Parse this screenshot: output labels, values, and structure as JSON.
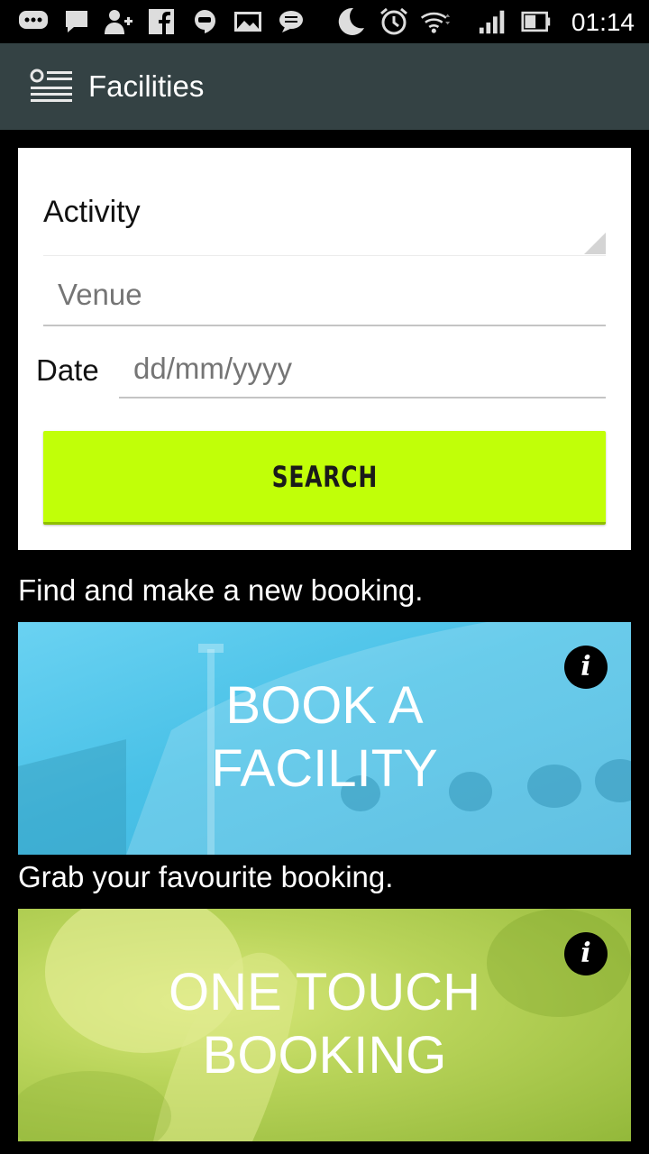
{
  "status_bar": {
    "time": "01:14",
    "icons": [
      "chat-icon",
      "message-icon",
      "add-user-icon",
      "facebook-icon",
      "hangouts-icon",
      "gallery-icon",
      "sms-icon",
      "moon-icon",
      "alarm-icon",
      "wifi-icon",
      "signal-icon",
      "battery-icon"
    ]
  },
  "app_bar": {
    "title": "Facilities",
    "menu_icon": "list-menu-icon"
  },
  "search_form": {
    "activity_label": "Activity",
    "venue_placeholder": "Venue",
    "date_label": "Date",
    "date_placeholder": "dd/mm/yyyy",
    "search_button": "SEARCH",
    "accent_color": "#c1ff08"
  },
  "sections": [
    {
      "caption": "Find and make a new booking.",
      "title_line1": "BOOK A",
      "title_line2": "FACILITY",
      "info_icon": "i",
      "color": "#4cc4ea"
    },
    {
      "caption": "Grab your favourite booking.",
      "title_line1": "ONE TOUCH",
      "title_line2": "BOOKING",
      "info_icon": "i",
      "color": "#b9d45a"
    }
  ]
}
